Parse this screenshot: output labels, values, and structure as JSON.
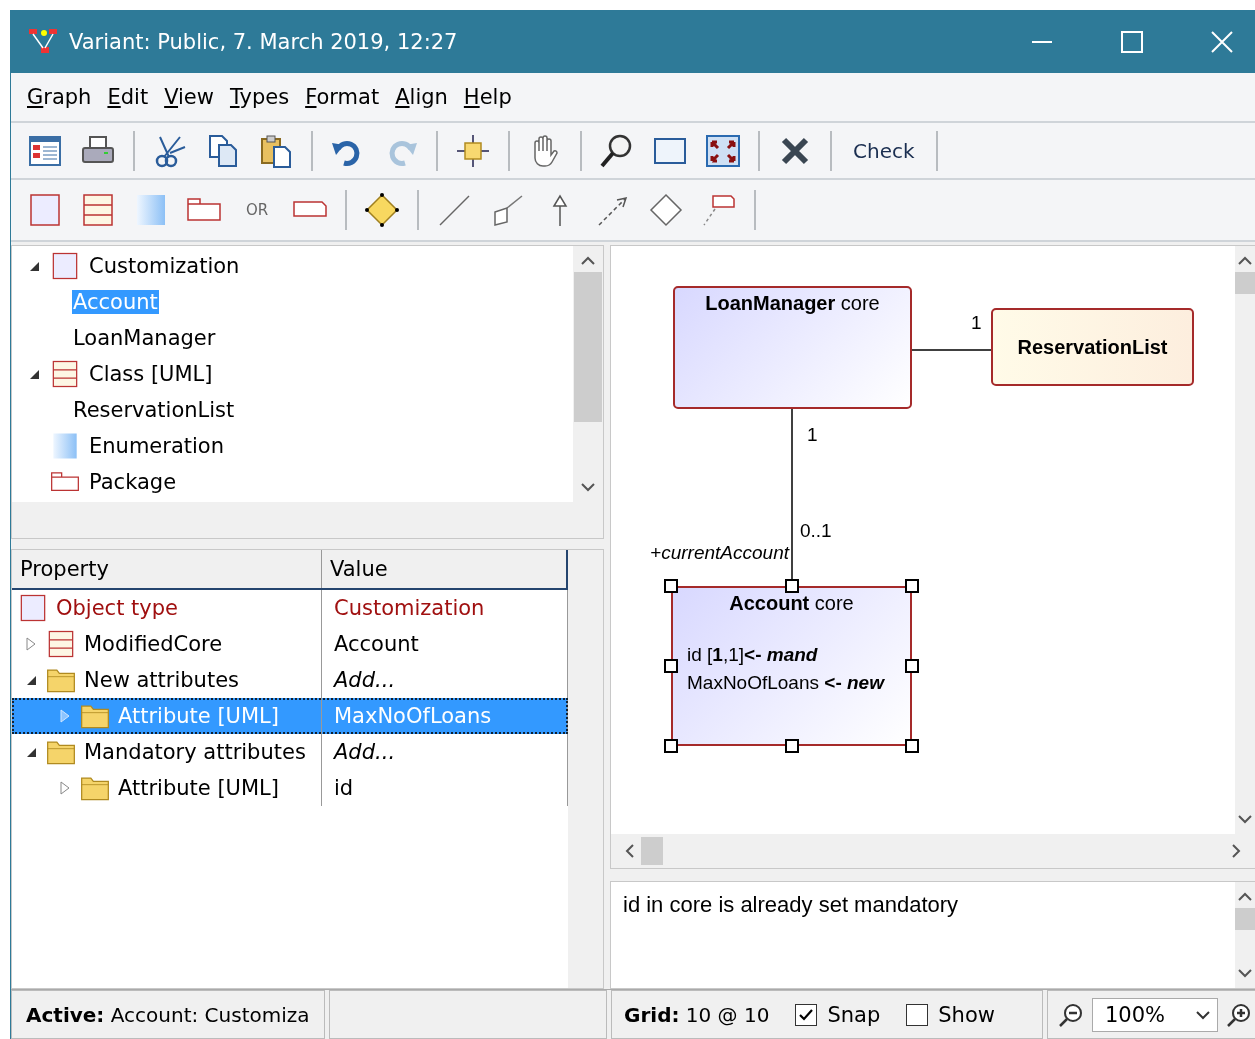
{
  "window": {
    "title": "Variant: Public, 7. March 2019, 12:27"
  },
  "menu": [
    {
      "key": "G",
      "rest": "raph"
    },
    {
      "key": "E",
      "rest": "dit"
    },
    {
      "key": "V",
      "rest": "iew"
    },
    {
      "key": "T",
      "rest": "ypes"
    },
    {
      "key": "F",
      "rest": "ormat"
    },
    {
      "key": "A",
      "rest": "lign"
    },
    {
      "key": "H",
      "rest": "elp"
    }
  ],
  "toolbar": {
    "redo_disabled": true,
    "check_button": "Check",
    "or_label": "OR"
  },
  "tree": [
    {
      "label": "Customization",
      "kind": "customization",
      "expanded": true,
      "selected": false,
      "children": [
        {
          "label": "Account",
          "selected": true
        },
        {
          "label": "LoanManager",
          "selected": false
        }
      ]
    },
    {
      "label": "Class [UML]",
      "kind": "class",
      "expanded": true,
      "selected": false,
      "children": [
        {
          "label": "ReservationList",
          "selected": false
        }
      ]
    },
    {
      "label": "Enumeration",
      "kind": "enumeration",
      "selected": false
    },
    {
      "label": "Package",
      "kind": "package",
      "selected": false
    }
  ],
  "properties": {
    "columns": [
      "Property",
      "Value"
    ],
    "rows": [
      {
        "property": "Object type",
        "value": "Customization",
        "kind": "type",
        "selected": false
      },
      {
        "property": "ModifiedCore",
        "value": "Account",
        "kind": "reference",
        "expanded": false,
        "selected": false
      },
      {
        "property": "New attributes",
        "value": "Add...",
        "kind": "group",
        "expanded": true,
        "selected": false,
        "children": [
          {
            "property": "Attribute [UML]",
            "value": "MaxNoOfLoans",
            "kind": "attribute",
            "expanded": false,
            "selected": true
          }
        ]
      },
      {
        "property": "Mandatory attributes",
        "value": "Add...",
        "kind": "group",
        "expanded": true,
        "selected": false,
        "children": [
          {
            "property": "Attribute [UML]",
            "value": "id",
            "kind": "attribute",
            "expanded": false,
            "selected": false
          }
        ]
      }
    ]
  },
  "diagram": {
    "nodes": [
      {
        "name": "LoanManager",
        "stereotype": "core",
        "kind": "customization",
        "selected": false
      },
      {
        "name": "ReservationList",
        "kind": "class",
        "selected": false
      },
      {
        "name": "Account",
        "stereotype": "core",
        "kind": "customization",
        "selected": true,
        "attributes": [
          "id [**1**,1]**<-** *mand*",
          "MaxNoOfLoans **<-** *new*"
        ]
      }
    ],
    "edges": [
      {
        "target_multiplicity": "1"
      },
      {
        "source_multiplicity": "1",
        "target_multiplicity": "0..1",
        "target_role": "+currentAccount"
      }
    ]
  },
  "message": "id in core is already set mandatory",
  "status_bar": {
    "active_label": "Active:",
    "active_value": "Account: Customiza",
    "grid_label": "Grid:",
    "grid_value": "10 @ 10",
    "snap": {
      "label": "Snap",
      "checked": true
    },
    "show": {
      "label": "Show",
      "checked": false
    },
    "zoom": "100%"
  }
}
